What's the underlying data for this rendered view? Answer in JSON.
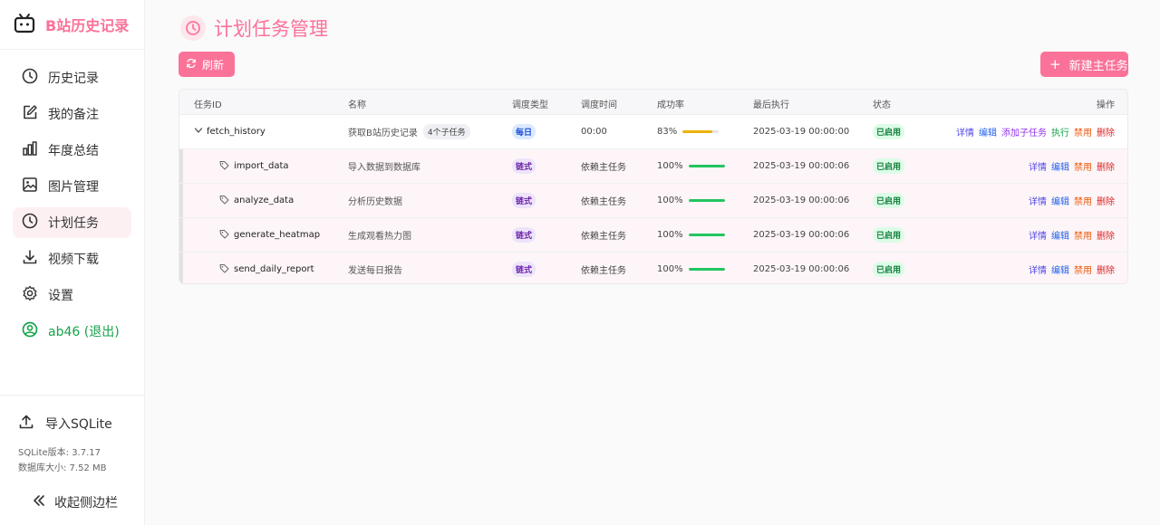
{
  "app": {
    "title": "B站历史记录"
  },
  "sidebar": {
    "items": [
      {
        "label": "历史记录",
        "icon": "clock-icon"
      },
      {
        "label": "我的备注",
        "icon": "edit-icon"
      },
      {
        "label": "年度总结",
        "icon": "bar-chart-icon"
      },
      {
        "label": "图片管理",
        "icon": "image-icon"
      },
      {
        "label": "计划任务",
        "icon": "clock-icon",
        "active": true
      },
      {
        "label": "视频下载",
        "icon": "download-icon"
      },
      {
        "label": "设置",
        "icon": "gear-icon"
      },
      {
        "label": "ab46 (退出)",
        "icon": "user-circle-icon"
      }
    ],
    "import_label": "导入SQLite",
    "sqlite_version": "SQLite版本: 3.7.17",
    "db_size": "数据库大小: 7.52 MB",
    "collapse_label": "收起侧边栏"
  },
  "page": {
    "title": "计划任务管理",
    "refresh_label": "刷新",
    "new_task_label": "新建主任务"
  },
  "colors": {
    "accent": "#fb7299",
    "success": "#22c55e",
    "warning": "#eab308"
  },
  "table": {
    "headers": {
      "id": "任务ID",
      "name": "名称",
      "schedule_type": "调度类型",
      "schedule_time": "调度时间",
      "success_rate": "成功率",
      "last_run": "最后执行",
      "status": "状态",
      "actions": "操作"
    },
    "main_task": {
      "id": "fetch_history",
      "name": "获取B站历史记录",
      "subtask_count": "4个子任务",
      "schedule_type": "每日",
      "schedule_time": "00:00",
      "success_rate": "83%",
      "success_fraction": 0.83,
      "last_run": "2025-03-19 00:00:00",
      "status": "已启用",
      "actions": {
        "detail": "详情",
        "edit": "编辑",
        "add_child": "添加子任务",
        "run": "执行",
        "disable": "禁用",
        "delete": "删除"
      }
    },
    "subtasks": [
      {
        "id": "import_data",
        "name": "导入数据到数据库",
        "schedule_type": "链式",
        "schedule_time": "依赖主任务",
        "success_rate": "100%",
        "success_fraction": 1.0,
        "last_run": "2025-03-19 00:00:06",
        "status": "已启用"
      },
      {
        "id": "analyze_data",
        "name": "分析历史数据",
        "schedule_type": "链式",
        "schedule_time": "依赖主任务",
        "success_rate": "100%",
        "success_fraction": 1.0,
        "last_run": "2025-03-19 00:00:06",
        "status": "已启用"
      },
      {
        "id": "generate_heatmap",
        "name": "生成观看热力图",
        "schedule_type": "链式",
        "schedule_time": "依赖主任务",
        "success_rate": "100%",
        "success_fraction": 1.0,
        "last_run": "2025-03-19 00:00:06",
        "status": "已启用"
      },
      {
        "id": "send_daily_report",
        "name": "发送每日报告",
        "schedule_type": "链式",
        "schedule_time": "依赖主任务",
        "success_rate": "100%",
        "success_fraction": 1.0,
        "last_run": "2025-03-19 00:00:06",
        "status": "已启用"
      }
    ],
    "sub_actions": {
      "detail": "详情",
      "edit": "编辑",
      "disable": "禁用",
      "delete": "删除"
    }
  }
}
